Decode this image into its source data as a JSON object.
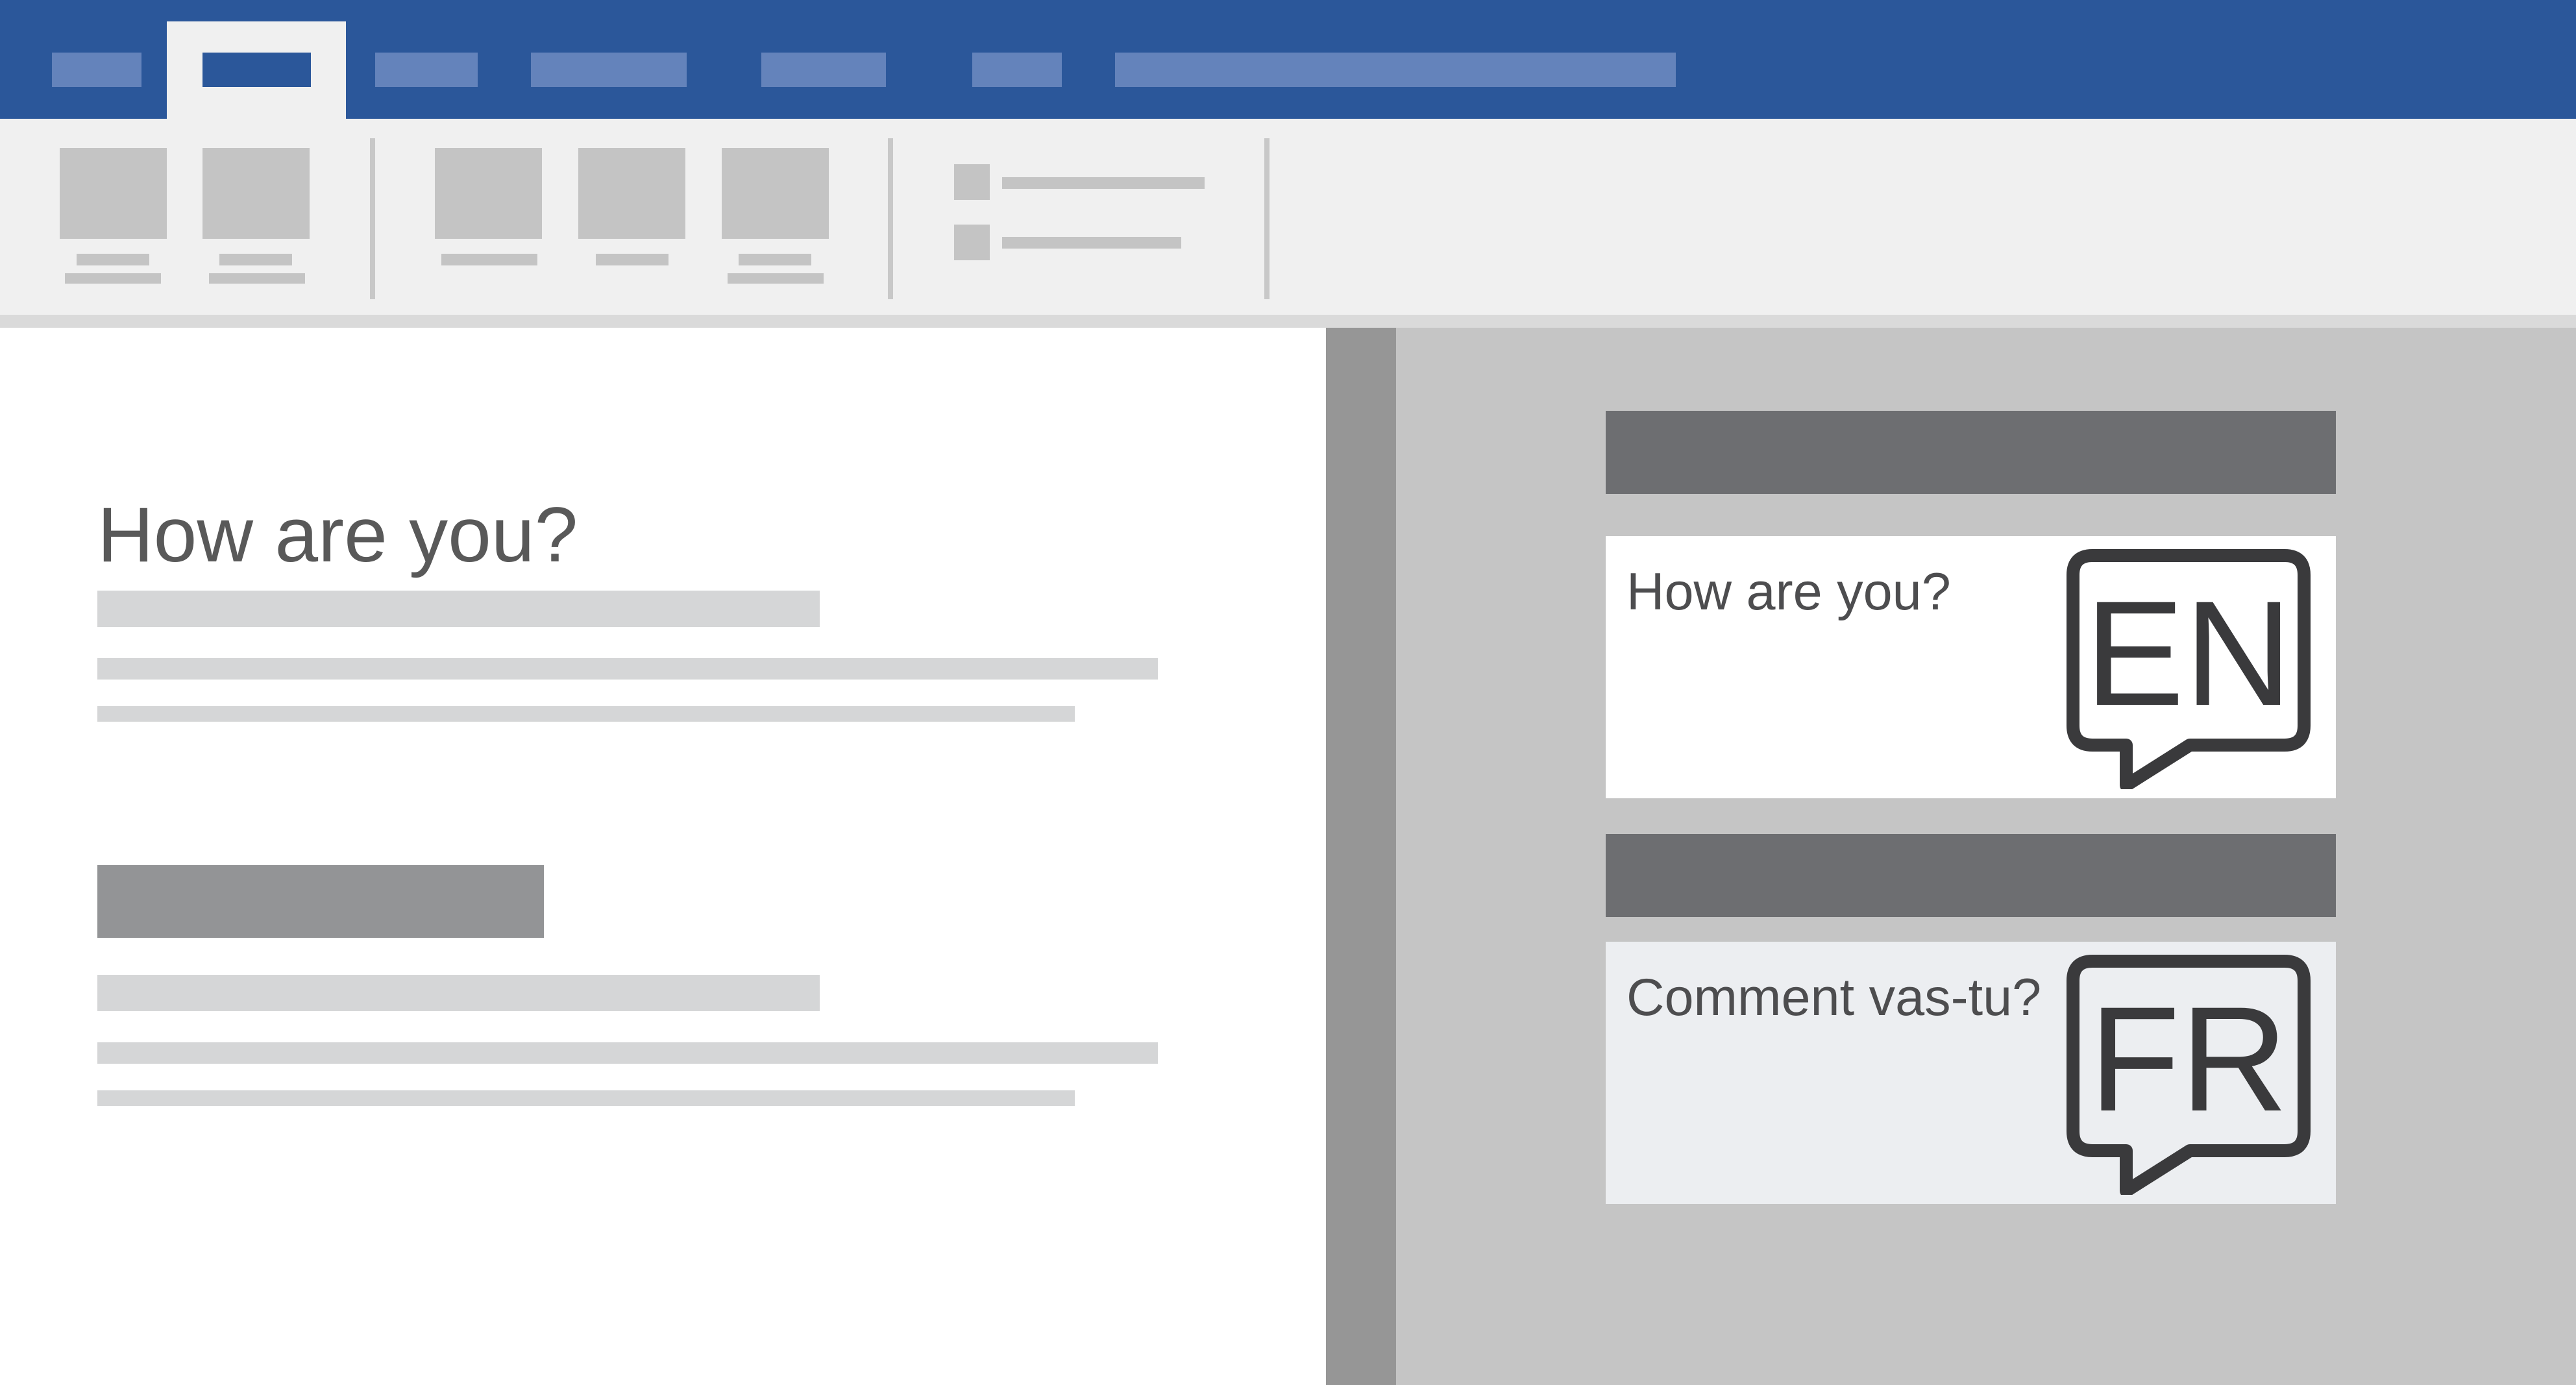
{
  "document": {
    "heading": "How are you?"
  },
  "translator": {
    "source": {
      "text": "How are you?",
      "language": "EN",
      "icon": "speech-bubble-icon"
    },
    "target": {
      "text": "Comment vas-tu?",
      "language": "FR",
      "icon": "speech-bubble-icon"
    }
  },
  "colors": {
    "title_bar": "#2b579a",
    "ribbon": "#f0f0f0",
    "pane": "#c5c5c5",
    "pane_header": "#6d6e71",
    "source_card": "#ffffff",
    "target_card": "#eceef1",
    "text": "#4d4d4f"
  }
}
